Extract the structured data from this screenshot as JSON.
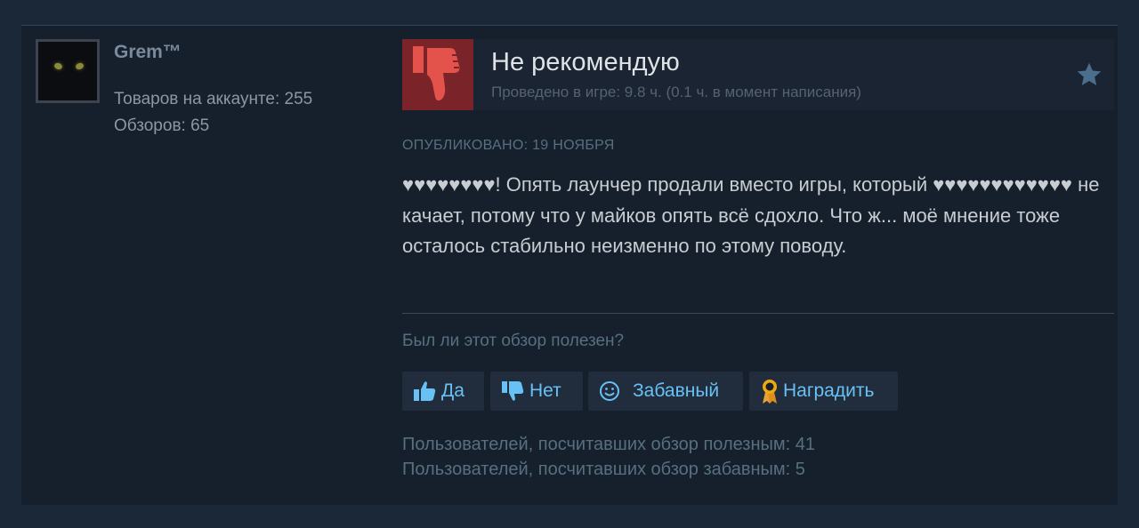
{
  "author": {
    "name": "Grem™",
    "products_line": "Товаров на аккаунте: 255",
    "reviews_line": "Обзоров: 65"
  },
  "review": {
    "verdict": "Не рекомендую",
    "playtime": "Проведено в игре: 9.8 ч. (0.1 ч. в момент написания)",
    "posted": "ОПУБЛИКОВАНО: 19 НОЯБРЯ",
    "body": "♥♥♥♥♥♥♥♥! Опять лаунчер продали вместо игры, который ♥♥♥♥♥♥♥♥♥♥♥♥ не качает, потому что у майков опять всё сдохло. Что ж... моё мнение тоже осталось стабильно неизменно по этому поводу."
  },
  "feedback": {
    "question": "Был ли этот обзор полезен?",
    "yes_label": "Да",
    "no_label": "Нет",
    "funny_label": "Забавный",
    "award_label": "Наградить",
    "helpful_count": "Пользователей, посчитавших обзор полезным: 41",
    "funny_count": "Пользователей, посчитавших обзор забавным: 5"
  },
  "icons": {
    "thumb": "thumbs-down-icon",
    "favorite": "star-icon",
    "yes": "thumbs-up-icon",
    "no": "thumbs-down-icon",
    "funny": "smiley-icon",
    "award": "award-ribbon-icon"
  },
  "colors": {
    "page_bg": "#1b2838",
    "panel_bg": "#16202d",
    "not_recommended": "#7a2329",
    "link_blue": "#67c1f5",
    "award_gold": "#f0a90e"
  }
}
